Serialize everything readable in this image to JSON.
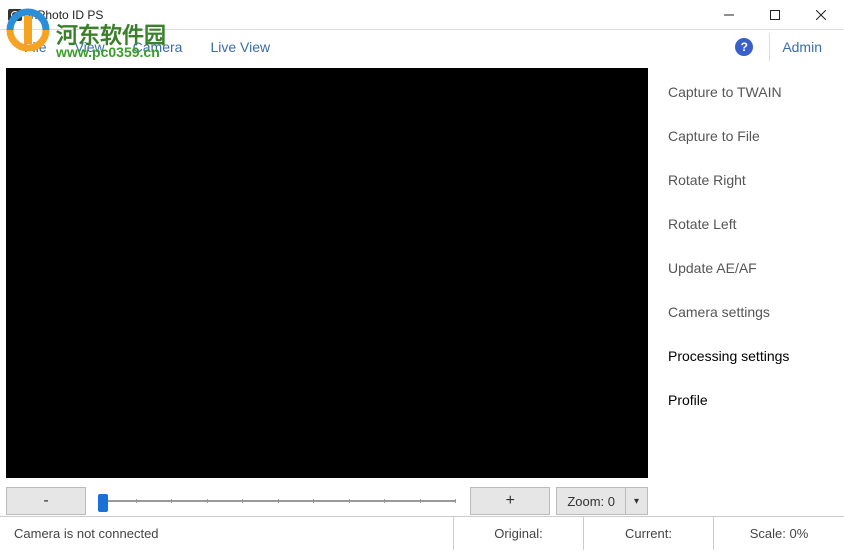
{
  "title": "inPhoto ID PS",
  "menu": {
    "file": "File",
    "view": "View",
    "camera": "Camera",
    "liveview": "Live View",
    "admin": "Admin"
  },
  "side": {
    "capture_twain": "Capture to TWAIN",
    "capture_file": "Capture to File",
    "rotate_right": "Rotate Right",
    "rotate_left": "Rotate Left",
    "update_aeaf": "Update AE/AF",
    "camera_settings": "Camera settings",
    "processing_settings": "Processing settings",
    "profile": "Profile"
  },
  "zoom": {
    "minus": "-",
    "plus": "+",
    "label": "Zoom: 0",
    "drop": "▾"
  },
  "status": {
    "msg": "Camera is not connected",
    "original": "Original:",
    "current": "Current:",
    "scale": "Scale: 0%"
  },
  "watermark": {
    "text1": "河东软件园",
    "text2": "www.pc0359.cn"
  }
}
